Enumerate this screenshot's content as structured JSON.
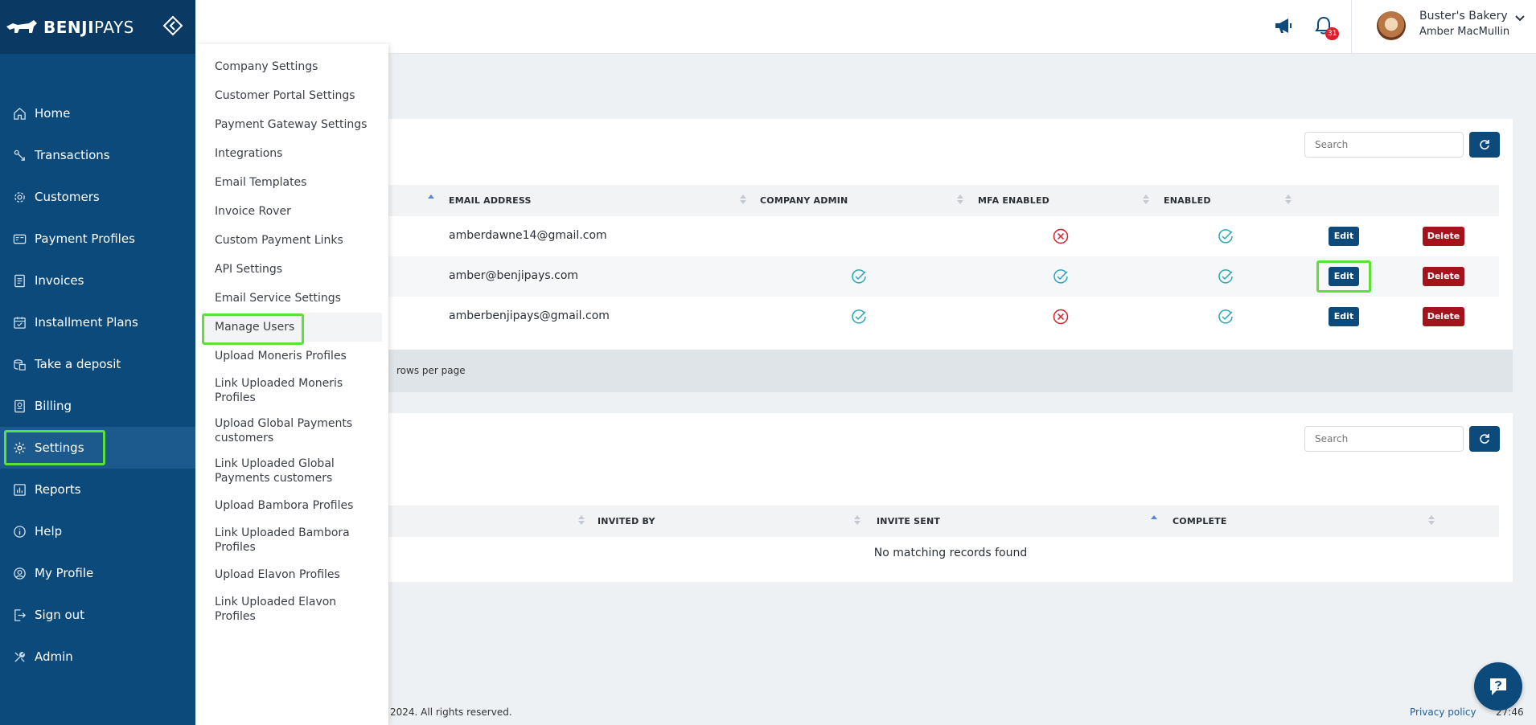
{
  "brand": {
    "name_bold": "BENJI",
    "name_light": "PAYS"
  },
  "sidebar": {
    "items": [
      {
        "label": "Home",
        "icon": "home-icon"
      },
      {
        "label": "Transactions",
        "icon": "transactions-icon"
      },
      {
        "label": "Customers",
        "icon": "customers-icon"
      },
      {
        "label": "Payment Profiles",
        "icon": "payment-profiles-icon"
      },
      {
        "label": "Invoices",
        "icon": "invoices-icon"
      },
      {
        "label": "Installment Plans",
        "icon": "calendar-icon"
      },
      {
        "label": "Take a deposit",
        "icon": "deposit-icon"
      },
      {
        "label": "Billing",
        "icon": "billing-icon"
      },
      {
        "label": "Settings",
        "icon": "gear-icon",
        "active": true
      },
      {
        "label": "Reports",
        "icon": "reports-icon"
      },
      {
        "label": "Help",
        "icon": "info-icon"
      },
      {
        "label": "My Profile",
        "icon": "profile-icon"
      },
      {
        "label": "Sign out",
        "icon": "sign-out-icon"
      },
      {
        "label": "Admin",
        "icon": "admin-icon"
      }
    ]
  },
  "settings_menu": {
    "items": [
      "Company Settings",
      "Customer Portal Settings",
      "Payment Gateway Settings",
      "Integrations",
      "Email Templates",
      "Invoice Rover",
      "Custom Payment Links",
      "API Settings",
      "Email Service Settings",
      "Manage Users",
      "Upload Moneris Profiles",
      "Link Uploaded Moneris Profiles",
      "Upload Global Payments customers",
      "Link Uploaded Global Payments customers",
      "Upload Bambora Profiles",
      "Link Uploaded Bambora Profiles",
      "Upload Elavon Profiles",
      "Link Uploaded Elavon Profiles"
    ],
    "active": "Manage Users"
  },
  "topbar": {
    "notification_count": "31",
    "company": "Buster's Bakery",
    "user": "Amber MacMullin"
  },
  "users_table": {
    "search_placeholder": "Search",
    "columns": [
      "EMAIL ADDRESS",
      "COMPANY ADMIN",
      "MFA ENABLED",
      "ENABLED"
    ],
    "rows": [
      {
        "email": "amberdawne14@gmail.com",
        "company_admin": false,
        "mfa_enabled": false,
        "enabled": true
      },
      {
        "email": "amber@benjipays.com",
        "company_admin": true,
        "mfa_enabled": true,
        "enabled": true
      },
      {
        "email": "amberbenjipays@gmail.com",
        "company_admin": true,
        "mfa_enabled": false,
        "enabled": true
      }
    ],
    "edit_label": "Edit",
    "delete_label": "Delete",
    "rows_per_page": "rows per page"
  },
  "invites_table": {
    "search_placeholder": "Search",
    "columns": [
      "INVITED BY",
      "INVITE SENT",
      "COMPLETE"
    ],
    "empty": "No matching records found"
  },
  "footer": {
    "copyright": "2024. All rights reserved.",
    "privacy": "Privacy policy",
    "time": "27:46"
  },
  "colors": {
    "primary": "#0d4a7c",
    "danger": "#a4121c",
    "highlight": "#5be13a",
    "check": "#2aa5b8",
    "cross": "#d1202b"
  }
}
